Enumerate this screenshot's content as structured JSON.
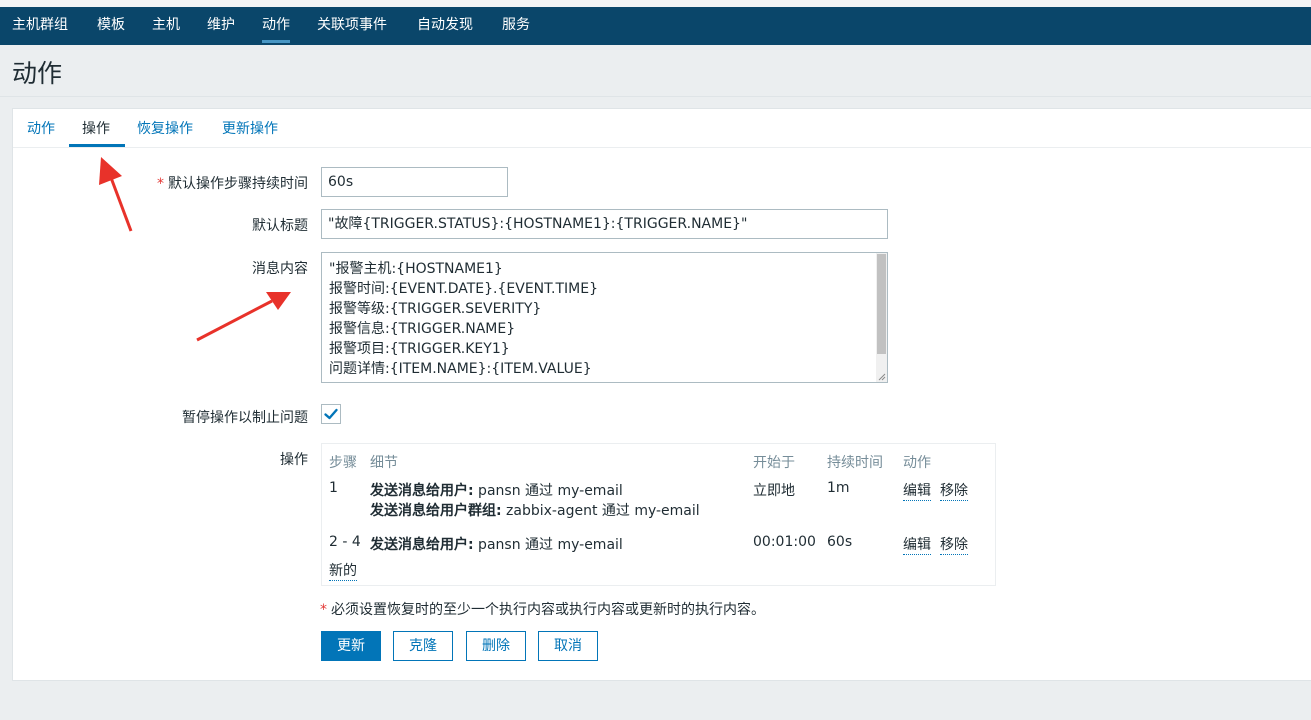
{
  "nav": {
    "items": [
      {
        "label": "主机群组"
      },
      {
        "label": "模板"
      },
      {
        "label": "主机"
      },
      {
        "label": "维护"
      },
      {
        "label": "动作"
      },
      {
        "label": "关联项事件"
      },
      {
        "label": "自动发现"
      },
      {
        "label": "服务"
      }
    ]
  },
  "page": {
    "title": "动作"
  },
  "tabs": [
    {
      "label": "动作"
    },
    {
      "label": "操作"
    },
    {
      "label": "恢复操作"
    },
    {
      "label": "更新操作"
    }
  ],
  "form": {
    "step_duration": {
      "required_mark": "*",
      "label": "默认操作步骤持续时间",
      "value": "60s"
    },
    "default_subject": {
      "label": "默认标题",
      "value": "\"故障{TRIGGER.STATUS}:{HOSTNAME1}:{TRIGGER.NAME}\""
    },
    "message": {
      "label": "消息内容",
      "lines": [
        "\"报警主机:{HOSTNAME1}",
        "报警时间:{EVENT.DATE}.{EVENT.TIME}",
        "报警等级:{TRIGGER.SEVERITY}",
        "报警信息:{TRIGGER.NAME}",
        "报警项目:{TRIGGER.KEY1}",
        "问题详情:{ITEM.NAME}:{ITEM.VALUE}"
      ]
    },
    "pause": {
      "label": "暂停操作以制止问题",
      "checked": true
    },
    "operations": {
      "label": "操作",
      "headers": {
        "steps": "步骤",
        "details": "细节",
        "start": "开始于",
        "duration": "持续时间",
        "action": "动作"
      },
      "rows": [
        {
          "steps": "1",
          "details": [
            {
              "bold": "发送消息给用户:",
              "text": " pansn 通过 my-email"
            },
            {
              "bold": "发送消息给用户群组:",
              "text": " zabbix-agent 通过 my-email"
            }
          ],
          "start": "立即地",
          "duration": "1m",
          "edit": "编辑",
          "remove": "移除"
        },
        {
          "steps": "2 - 4",
          "details": [
            {
              "bold": "发送消息给用户:",
              "text": " pansn 通过 my-email"
            }
          ],
          "start": "00:01:00",
          "duration": "60s",
          "edit": "编辑",
          "remove": "移除"
        }
      ],
      "new_label": "新的"
    },
    "note": {
      "mark": "*",
      "text": "必须设置恢复时的至少一个执行内容或执行内容或更新时的执行内容。"
    }
  },
  "buttons": {
    "update": "更新",
    "clone": "克隆",
    "delete": "删除",
    "cancel": "取消"
  },
  "colors": {
    "nav_bg": "#0a466a",
    "accent": "#0275b8",
    "required": "#e33734",
    "annotation_arrow": "#e8322a"
  }
}
